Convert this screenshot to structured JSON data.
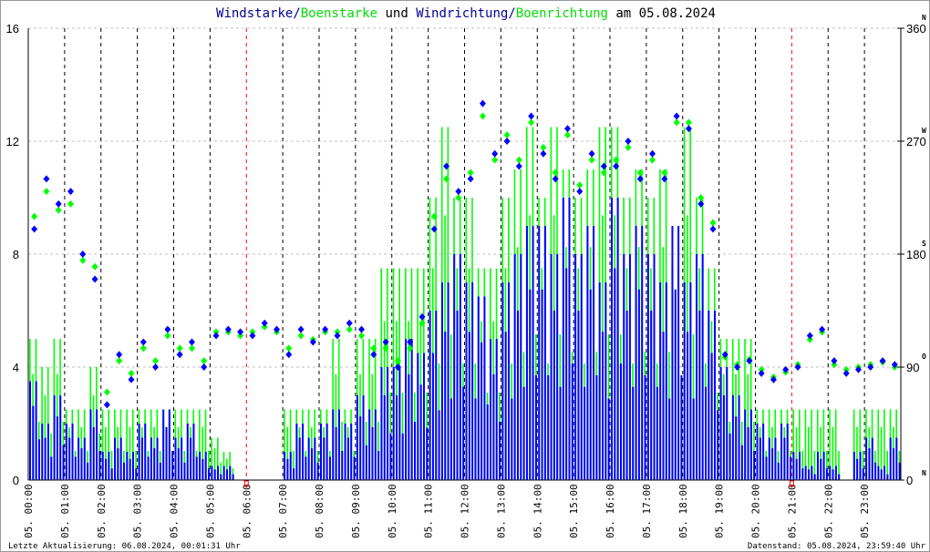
{
  "title": {
    "part1": "Windstarke",
    "sep1": "/",
    "part2": "Boenstarke",
    "mid": " und ",
    "part3": "Windrichtung",
    "sep2": "/",
    "part4": "Boenrichtung",
    "tail": " am 05.08.2024"
  },
  "footer": {
    "left": "Letzte Aktualisierung: 06.08.2024, 00:01:31 Uhr",
    "right": "Datenstand: 05.08.2024, 23:59:40 Uhr"
  },
  "colors": {
    "wind": "#0000ff",
    "gust": "#00ff00",
    "title_wind": "#000099",
    "grid": "#c0c0c0",
    "marker": "#ff0000"
  },
  "chart_data": {
    "type": "bar+scatter",
    "title": "Windstarke/Boenstarke und Windrichtung/Boenrichtung am 05.08.2024",
    "left_axis": {
      "ylim": [
        0,
        16
      ],
      "ticks": [
        "0",
        "4",
        "8",
        "12",
        "16"
      ]
    },
    "right_axis": {
      "ylim": [
        0,
        360
      ],
      "ticks": [
        "0",
        "90",
        "180",
        "270",
        "360"
      ],
      "compass": [
        "N",
        "O",
        "S",
        "W",
        "N"
      ]
    },
    "x_ticks": [
      "05. 00:00",
      "05. 01:00",
      "05. 02:00",
      "05. 03:00",
      "05. 04:00",
      "05. 05:00",
      "05. 06:00",
      "05. 07:00",
      "05. 08:00",
      "05. 09:00",
      "05. 10:00",
      "05. 11:00",
      "05. 12:00",
      "05. 13:00",
      "05. 14:00",
      "05. 15:00",
      "05. 16:00",
      "05. 17:00",
      "05. 18:00",
      "05. 19:00",
      "05. 20:00",
      "05. 21:00",
      "05. 22:00",
      "05. 23:00"
    ],
    "xlim_hours": [
      0,
      24
    ],
    "sample_interval_min": 20,
    "marker_hours": [
      6,
      21
    ],
    "series": [
      {
        "name": "Windstarke",
        "kind": "bar",
        "color": "#0000ff",
        "values": [
          3.5,
          2,
          3,
          2,
          1.5,
          2.5,
          1,
          1.5,
          1,
          2,
          1.5,
          2.5,
          1.5,
          2,
          1,
          0.5,
          0.5,
          0,
          0,
          0,
          0,
          1,
          2,
          1.5,
          2,
          2.5,
          2,
          3,
          2.5,
          4,
          4,
          5,
          4.5,
          6,
          7,
          8,
          7,
          6.5,
          5,
          7,
          8,
          9,
          9,
          8,
          10,
          8,
          9,
          7,
          10,
          8,
          9,
          8,
          7,
          9,
          7,
          8,
          6,
          4,
          3,
          2.5,
          2,
          1.5,
          2,
          1,
          0.5,
          1,
          0.5,
          0,
          1,
          1.5,
          0.5,
          1.5
        ]
      },
      {
        "name": "Boenstarke",
        "kind": "bar",
        "color": "#00ff00",
        "values": [
          5,
          4,
          5,
          2.5,
          2.5,
          4,
          2.5,
          2.5,
          2.5,
          2.5,
          2.5,
          2.5,
          2.5,
          2.5,
          2.5,
          1.5,
          1,
          0,
          0,
          0,
          0,
          2.5,
          2.5,
          2.5,
          2.5,
          5,
          2.5,
          5,
          5,
          7.5,
          7.5,
          7.5,
          7.5,
          10,
          12.5,
          10,
          10,
          7.5,
          7.5,
          10,
          11,
          12.5,
          10,
          12.5,
          11,
          10,
          11,
          12.5,
          12.5,
          10,
          11,
          10,
          11,
          7.5,
          12.5,
          10,
          7.5,
          5,
          5,
          5,
          2.5,
          2.5,
          2.5,
          2.5,
          2.5,
          2.5,
          2.5,
          0,
          2.5,
          2.5,
          2.5,
          2.5
        ]
      },
      {
        "name": "Windrichtung",
        "kind": "scatter",
        "color": "#0000ff",
        "values": [
          200,
          240,
          220,
          230,
          180,
          160,
          60,
          100,
          80,
          110,
          90,
          120,
          100,
          110,
          90,
          115,
          120,
          118,
          115,
          125,
          120,
          100,
          120,
          110,
          120,
          115,
          125,
          120,
          100,
          110,
          90,
          110,
          130,
          200,
          250,
          230,
          240,
          300,
          260,
          270,
          250,
          290,
          260,
          240,
          280,
          230,
          260,
          250,
          250,
          270,
          240,
          260,
          240,
          290,
          280,
          220,
          200,
          100,
          90,
          95,
          85,
          80,
          88,
          90,
          115,
          120,
          95,
          85,
          88,
          90,
          95,
          92
        ]
      },
      {
        "name": "Boenrichtung",
        "kind": "scatter",
        "color": "#00ff00",
        "values": [
          210,
          230,
          215,
          220,
          175,
          170,
          70,
          95,
          85,
          105,
          95,
          115,
          105,
          105,
          95,
          118,
          118,
          115,
          118,
          122,
          118,
          105,
          115,
          112,
          118,
          118,
          120,
          115,
          105,
          105,
          95,
          105,
          125,
          210,
          240,
          225,
          245,
          290,
          255,
          275,
          255,
          285,
          265,
          245,
          275,
          235,
          255,
          245,
          255,
          265,
          245,
          255,
          245,
          285,
          285,
          225,
          205,
          98,
          92,
          96,
          88,
          82,
          86,
          92,
          112,
          118,
          92,
          88,
          90,
          92,
          94,
          90
        ]
      }
    ]
  }
}
